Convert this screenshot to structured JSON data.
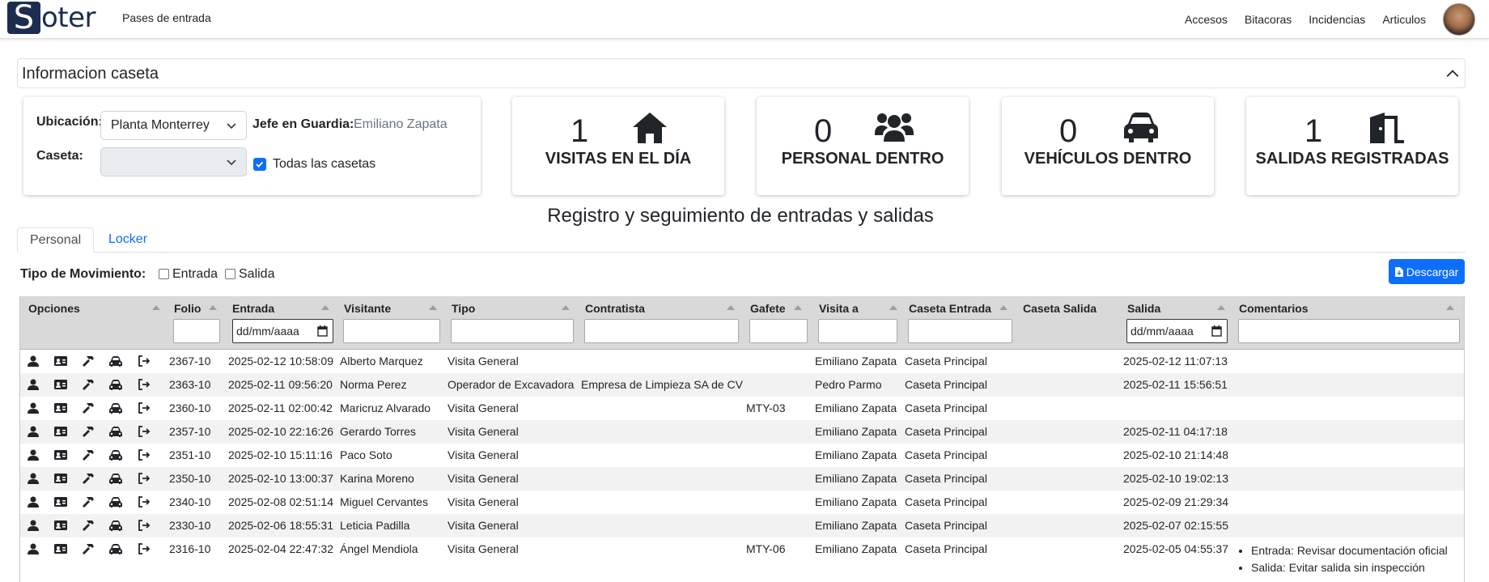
{
  "nav": {
    "logo_letter": "S",
    "logo_rest": "oter",
    "left_link": "Pases de entrada",
    "links": [
      "Accesos",
      "Bitacoras",
      "Incidencias",
      "Articulos"
    ]
  },
  "accordion": {
    "title": "Informacion caseta"
  },
  "location": {
    "ubicacion_label": "Ubicación:",
    "ubicacion_value": "Planta Monterrey",
    "caseta_label": "Caseta:",
    "caseta_value": "",
    "jefe_label": "Jefe en Guardia:",
    "jefe_value": "Emiliano Zapata",
    "todas_label": "Todas las casetas",
    "todas_checked": true
  },
  "stats": [
    {
      "value": "1",
      "label": "VISITAS EN EL DÍA",
      "icon": "home-icon"
    },
    {
      "value": "0",
      "label": "PERSONAL DENTRO",
      "icon": "users-icon"
    },
    {
      "value": "0",
      "label": "VEHÍCULOS DENTRO",
      "icon": "car-icon"
    },
    {
      "value": "1",
      "label": "SALIDAS REGISTRADAS",
      "icon": "door-open-icon"
    }
  ],
  "main_title": "Registro y seguimiento de entradas y salidas",
  "tabs": [
    "Personal",
    "Locker"
  ],
  "movement": {
    "label": "Tipo de Movimiento:",
    "entrada": "Entrada",
    "salida": "Salida"
  },
  "download_label": "Descargar",
  "table": {
    "headers": [
      "Opciones",
      "Folio",
      "Entrada",
      "Visitante",
      "Tipo",
      "Contratista",
      "Gafete",
      "Visita a",
      "Caseta Entrada",
      "Caseta Salida",
      "Salida",
      "Comentarios"
    ],
    "date_placeholder": "dd/mm/aaaa",
    "rows": [
      {
        "folio": "2367-10",
        "entrada": "2025-02-12 10:58:09",
        "visitante": "Alberto Marquez",
        "tipo": "Visita General",
        "contratista": "",
        "gafete": "",
        "visita": "Emiliano Zapata",
        "caseta_entrada": "Caseta Principal",
        "caseta_salida": "",
        "salida": "2025-02-12 11:07:13"
      },
      {
        "folio": "2363-10",
        "entrada": "2025-02-11 09:56:20",
        "visitante": "Norma Perez",
        "tipo": "Operador de Excavadora",
        "contratista": "Empresa de Limpieza SA de CV",
        "gafete": "",
        "visita": "Pedro Parmo",
        "caseta_entrada": "Caseta Principal",
        "caseta_salida": "",
        "salida": "2025-02-11 15:56:51"
      },
      {
        "folio": "2360-10",
        "entrada": "2025-02-11 02:00:42",
        "visitante": "Maricruz Alvarado",
        "tipo": "Visita General",
        "contratista": "",
        "gafete": "MTY-03",
        "visita": "Emiliano Zapata",
        "caseta_entrada": "Caseta Principal",
        "caseta_salida": "",
        "salida": ""
      },
      {
        "folio": "2357-10",
        "entrada": "2025-02-10 22:16:26",
        "visitante": "Gerardo Torres",
        "tipo": "Visita General",
        "contratista": "",
        "gafete": "",
        "visita": "Emiliano Zapata",
        "caseta_entrada": "Caseta Principal",
        "caseta_salida": "",
        "salida": "2025-02-11 04:17:18"
      },
      {
        "folio": "2351-10",
        "entrada": "2025-02-10 15:11:16",
        "visitante": "Paco Soto",
        "tipo": "Visita General",
        "contratista": "",
        "gafete": "",
        "visita": "Emiliano Zapata",
        "caseta_entrada": "Caseta Principal",
        "caseta_salida": "",
        "salida": "2025-02-10 21:14:48"
      },
      {
        "folio": "2350-10",
        "entrada": "2025-02-10 13:00:37",
        "visitante": "Karina Moreno",
        "tipo": "Visita General",
        "contratista": "",
        "gafete": "",
        "visita": "Emiliano Zapata",
        "caseta_entrada": "Caseta Principal",
        "caseta_salida": "",
        "salida": "2025-02-10 19:02:13"
      },
      {
        "folio": "2340-10",
        "entrada": "2025-02-08 02:51:14",
        "visitante": "Miguel Cervantes",
        "tipo": "Visita General",
        "contratista": "",
        "gafete": "",
        "visita": "Emiliano Zapata",
        "caseta_entrada": "Caseta Principal",
        "caseta_salida": "",
        "salida": "2025-02-09 21:29:34"
      },
      {
        "folio": "2330-10",
        "entrada": "2025-02-06 18:55:31",
        "visitante": "Leticia Padilla",
        "tipo": "Visita General",
        "contratista": "",
        "gafete": "",
        "visita": "Emiliano Zapata",
        "caseta_entrada": "Caseta Principal",
        "caseta_salida": "",
        "salida": "2025-02-07 02:15:55"
      },
      {
        "folio": "2316-10",
        "entrada": "2025-02-04 22:47:32",
        "visitante": "Ángel Mendiola",
        "tipo": "Visita General",
        "contratista": "",
        "gafete": "MTY-06",
        "visita": "Emiliano Zapata",
        "caseta_entrada": "Caseta Principal",
        "caseta_salida": "",
        "salida": "2025-02-05 04:55:37",
        "comentarios": [
          "Entrada: Revisar documentación oficial",
          "Salida: Evitar salida sin inspección"
        ]
      }
    ]
  },
  "colors": {
    "brand": "#1d2d50",
    "primary": "#0d6efd"
  }
}
